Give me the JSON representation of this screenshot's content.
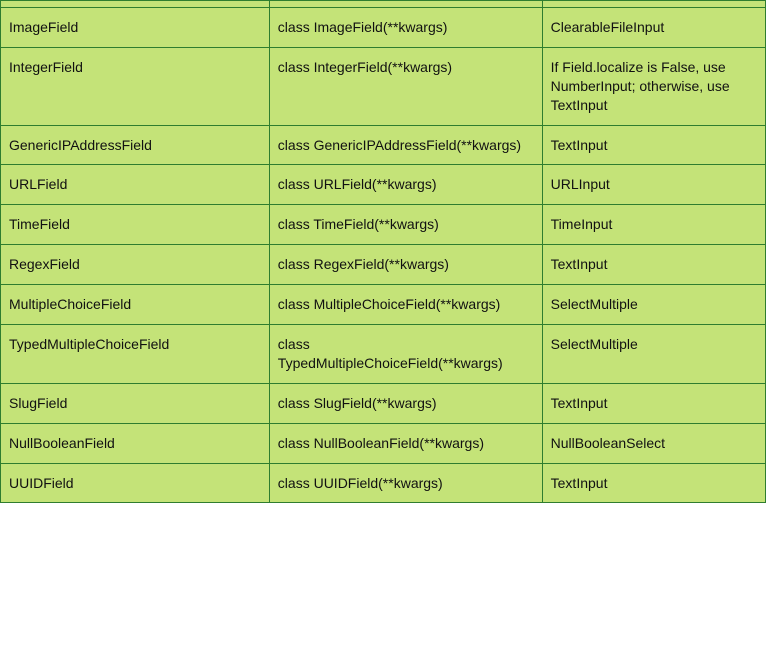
{
  "table": {
    "rows": [
      {
        "name": "ImageField",
        "class_def": "class ImageField(**kwargs)",
        "widget": "ClearableFileInput"
      },
      {
        "name": "IntegerField",
        "class_def": "class IntegerField(**kwargs)",
        "widget": "If Field.localize is False, use NumberInput; otherwise, use TextInput"
      },
      {
        "name": "GenericIPAddressField",
        "class_def": "class GenericIPAddressField(**kwargs)",
        "widget": "TextInput"
      },
      {
        "name": "URLField",
        "class_def": "class URLField(**kwargs)",
        "widget": "URLInput"
      },
      {
        "name": "TimeField",
        "class_def": "class TimeField(**kwargs)",
        "widget": "TimeInput"
      },
      {
        "name": "RegexField",
        "class_def": "class RegexField(**kwargs)",
        "widget": "TextInput"
      },
      {
        "name": "MultipleChoiceField",
        "class_def": "class MultipleChoiceField(**kwargs)",
        "widget": "SelectMultiple"
      },
      {
        "name": "TypedMultipleChoiceField",
        "class_def": "class TypedMultipleChoiceField(**kwargs)",
        "widget": "SelectMultiple"
      },
      {
        "name": "SlugField",
        "class_def": "class SlugField(**kwargs)",
        "widget": "TextInput"
      },
      {
        "name": "NullBooleanField",
        "class_def": "class NullBooleanField(**kwargs)",
        "widget": "NullBooleanSelect"
      },
      {
        "name": "UUIDField",
        "class_def": "class UUIDField(**kwargs)",
        "widget": "TextInput"
      }
    ]
  }
}
